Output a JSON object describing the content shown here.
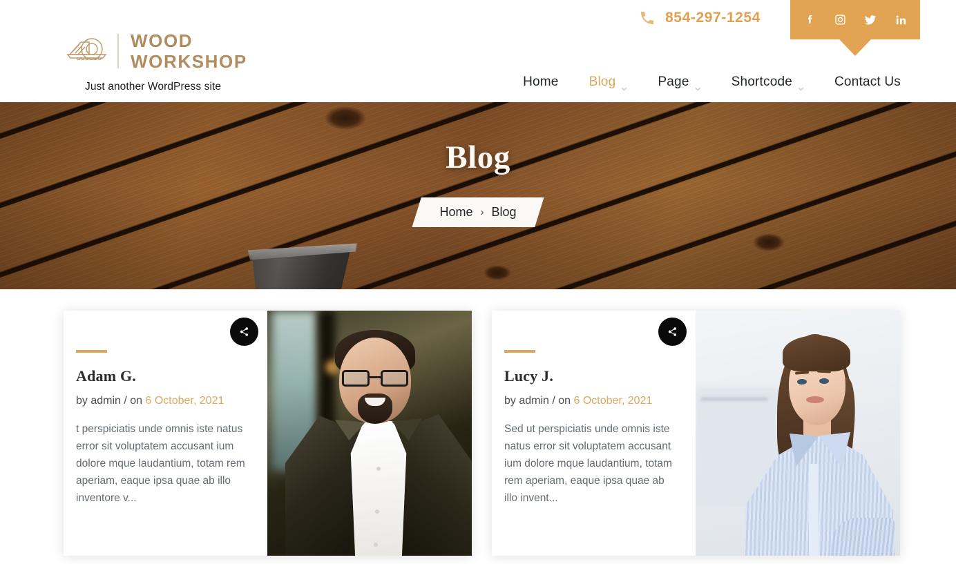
{
  "header": {
    "logo": {
      "icon": "circular-saw-icon",
      "line1": "Wood",
      "line2": "Workshop",
      "text": "WOOD WORKSHOP"
    },
    "tagline": "Just another WordPress site",
    "phone": {
      "icon": "phone-icon",
      "number": "854-297-1254"
    },
    "social": [
      {
        "name": "facebook",
        "label": "f"
      },
      {
        "name": "instagram",
        "label": "Instagram"
      },
      {
        "name": "twitter",
        "label": "Twitter"
      },
      {
        "name": "linkedin",
        "label": "in"
      }
    ],
    "nav": [
      {
        "label": "Home",
        "active": false,
        "has_dropdown": false
      },
      {
        "label": "Blog",
        "active": true,
        "has_dropdown": true
      },
      {
        "label": "Page",
        "active": false,
        "has_dropdown": true
      },
      {
        "label": "Shortcode",
        "active": false,
        "has_dropdown": true
      },
      {
        "label": "Contact Us",
        "active": false,
        "has_dropdown": false
      }
    ]
  },
  "hero": {
    "title": "Blog",
    "breadcrumb": {
      "home": "Home",
      "separator": "›",
      "current": "Blog"
    }
  },
  "posts": [
    {
      "title": "Adam G.",
      "meta_prefix": "by admin / on",
      "date": "6 October, 2021",
      "excerpt": "t perspiciatis unde omnis iste natus error sit voluptatem accusant ium dolore mque laudantium, totam rem aperiam, eaque ipsa quae ab illo inventore v...",
      "share_label": "Share",
      "image_alt": "man-portrait"
    },
    {
      "title": "Lucy J.",
      "meta_prefix": "by admin / on",
      "date": "6 October, 2021",
      "excerpt": "Sed ut perspiciatis unde omnis iste natus error sit voluptatem accusant ium dolore mque laudantium, totam rem aperiam, eaque ipsa quae ab illo invent...",
      "share_label": "Share",
      "image_alt": "woman-portrait"
    }
  ],
  "colors": {
    "accent": "#dca85e",
    "accent_bar": "#e2a352",
    "brand_text": "#b08d5f",
    "body_text": "#22262a",
    "muted_text": "#636b70"
  }
}
